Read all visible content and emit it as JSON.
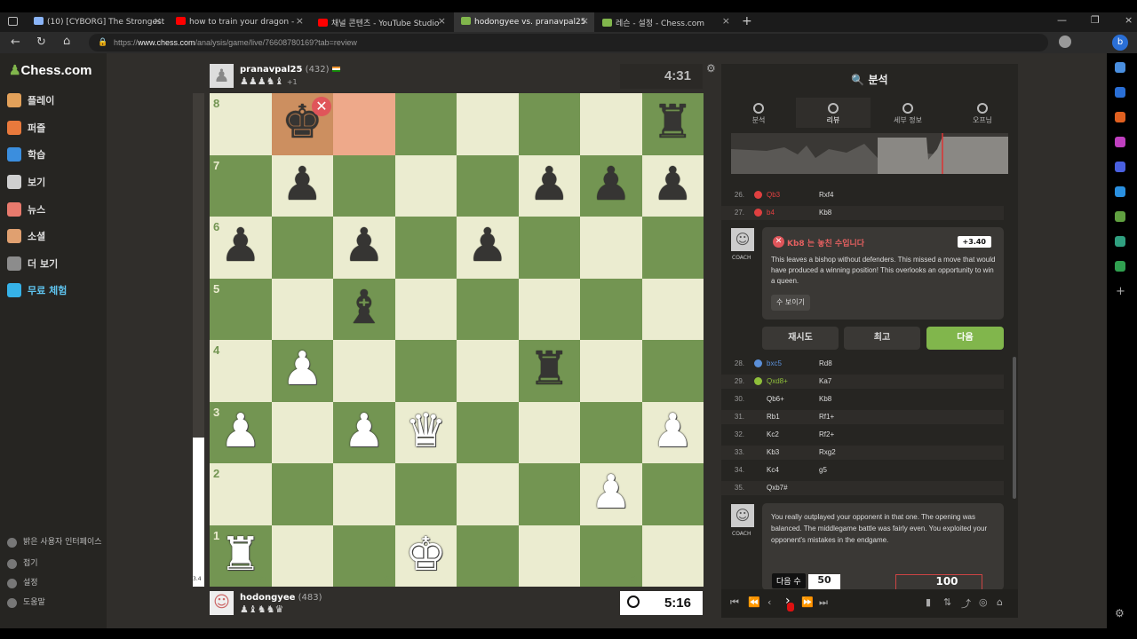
{
  "browser": {
    "tabs": [
      {
        "label": "(10) [CYBORG] The Strongest Ba",
        "icon_color": "#8ab4f8"
      },
      {
        "label": "how to train your dragon -",
        "icon_color": "#ff0000"
      },
      {
        "label": "채널 콘텐츠 - YouTube Studio",
        "icon_color": "#ff0000"
      },
      {
        "label": "hodongyee vs. pranavpal25",
        "icon_color": "#81b64c"
      },
      {
        "label": "레슨 - 설정 - Chess.com",
        "icon_color": "#81b64c"
      }
    ],
    "url_prefix": "https://",
    "url_host": "www.chess.com",
    "url_path": "/analysis/game/live/76608780169?tab=review"
  },
  "nav": {
    "logo": "Chess.com",
    "items": [
      {
        "label": "플레이",
        "icon_color": "#e2a15a"
      },
      {
        "label": "퍼즐",
        "icon_color": "#e8793c"
      },
      {
        "label": "학습",
        "icon_color": "#3b8ede"
      },
      {
        "label": "보기",
        "icon_color": "#cfcfcf"
      },
      {
        "label": "뉴스",
        "icon_color": "#e87a6d"
      },
      {
        "label": "소셜",
        "icon_color": "#e0a070"
      },
      {
        "label": "더 보기",
        "icon_color": "#8c8c8c"
      },
      {
        "label": "무료 체험",
        "icon_color": "#36b2e8"
      }
    ],
    "bottom": [
      "밝은 사용자 인터페이스",
      "접기",
      "설정",
      "도움말"
    ]
  },
  "game": {
    "top_player": {
      "name": "pranavpal25",
      "rating": "(432)",
      "captured": "♟♟♟♞♝",
      "extra": "+1"
    },
    "bottom_player": {
      "name": "hodongyee",
      "rating": "(483)",
      "captured": "♟♝♞♞♛"
    },
    "top_clock": "4:31",
    "bottom_clock": "5:16",
    "eval_small": "3.4"
  },
  "board": {
    "pieces": [
      {
        "sq": "b8",
        "glyph": "♚",
        "color": "b"
      },
      {
        "sq": "h8",
        "glyph": "♜",
        "color": "b"
      },
      {
        "sq": "b7",
        "glyph": "♟",
        "color": "b"
      },
      {
        "sq": "f7",
        "glyph": "♟",
        "color": "b"
      },
      {
        "sq": "g7",
        "glyph": "♟",
        "color": "b"
      },
      {
        "sq": "h7",
        "glyph": "♟",
        "color": "b"
      },
      {
        "sq": "a6",
        "glyph": "♟",
        "color": "b"
      },
      {
        "sq": "c6",
        "glyph": "♟",
        "color": "b"
      },
      {
        "sq": "e6",
        "glyph": "♟",
        "color": "b"
      },
      {
        "sq": "c5",
        "glyph": "♝",
        "color": "b"
      },
      {
        "sq": "b4",
        "glyph": "♟",
        "color": "w"
      },
      {
        "sq": "f4",
        "glyph": "♜",
        "color": "b"
      },
      {
        "sq": "a3",
        "glyph": "♟",
        "color": "w"
      },
      {
        "sq": "c3",
        "glyph": "♟",
        "color": "w"
      },
      {
        "sq": "d3",
        "glyph": "♛",
        "color": "w"
      },
      {
        "sq": "h3",
        "glyph": "♟",
        "color": "w"
      },
      {
        "sq": "g2",
        "glyph": "♟",
        "color": "w"
      },
      {
        "sq": "a1",
        "glyph": "♜",
        "color": "w"
      },
      {
        "sq": "d1",
        "glyph": "♚",
        "color": "w"
      }
    ],
    "highlight": [
      "b8",
      "c8"
    ],
    "files": [
      "a",
      "b",
      "c",
      "d",
      "e",
      "f",
      "g",
      "h"
    ],
    "ranks": [
      "8",
      "7",
      "6",
      "5",
      "4",
      "3",
      "2",
      "1"
    ],
    "light": "#ebecd0",
    "dark": "#739552"
  },
  "review": {
    "header": "분석",
    "tabs": [
      "분석",
      "리뷰",
      "세부 정보",
      "오프닝"
    ],
    "moves_top": [
      {
        "n": "26.",
        "w": "Qb3",
        "b": "Rxf4",
        "wcolor": "#e04040"
      },
      {
        "n": "27.",
        "w": "b4",
        "b": "Kb8",
        "wcolor": "#e04040"
      }
    ],
    "coach1": {
      "label": "COACH",
      "title": "Kb8 는 놓친 수입니다",
      "eval": "+3.40",
      "text": "This leaves a bishop without defenders. This missed a move that would have produced a winning position! This overlooks an opportunity to win a queen.",
      "show": "수 보이기"
    },
    "buttons": {
      "retry": "재시도",
      "best": "최고",
      "next": "다음"
    },
    "moves": [
      {
        "n": "28.",
        "w": "bxc5",
        "b": "Rd8",
        "wcolor": "#5b8fd8"
      },
      {
        "n": "29.",
        "w": "Qxd8+",
        "b": "Ka7",
        "wcolor": "#8fbf3a"
      },
      {
        "n": "30.",
        "w": "Qb6+",
        "b": "Kb8",
        "wcolor": "#cfcfcf"
      },
      {
        "n": "31.",
        "w": "Rb1",
        "b": "Rf1+",
        "wcolor": "#cfcfcf"
      },
      {
        "n": "32.",
        "w": "Kc2",
        "b": "Rf2+",
        "wcolor": "#cfcfcf"
      },
      {
        "n": "33.",
        "w": "Kb3",
        "b": "Rxg2",
        "wcolor": "#cfcfcf"
      },
      {
        "n": "34.",
        "w": "Kc4",
        "b": "g5",
        "wcolor": "#cfcfcf"
      },
      {
        "n": "35.",
        "w": "Qxb7#",
        "b": "",
        "wcolor": "#cfcfcf"
      }
    ],
    "coach2": {
      "label": "COACH",
      "text": "You really outplayed your opponent in that one. The opening was balanced. The middlegame battle was fairly even. You exploited your opponent's mistakes in the endgame."
    },
    "acc_left": "50",
    "acc_right": "100",
    "tooltip": "다음 수"
  }
}
